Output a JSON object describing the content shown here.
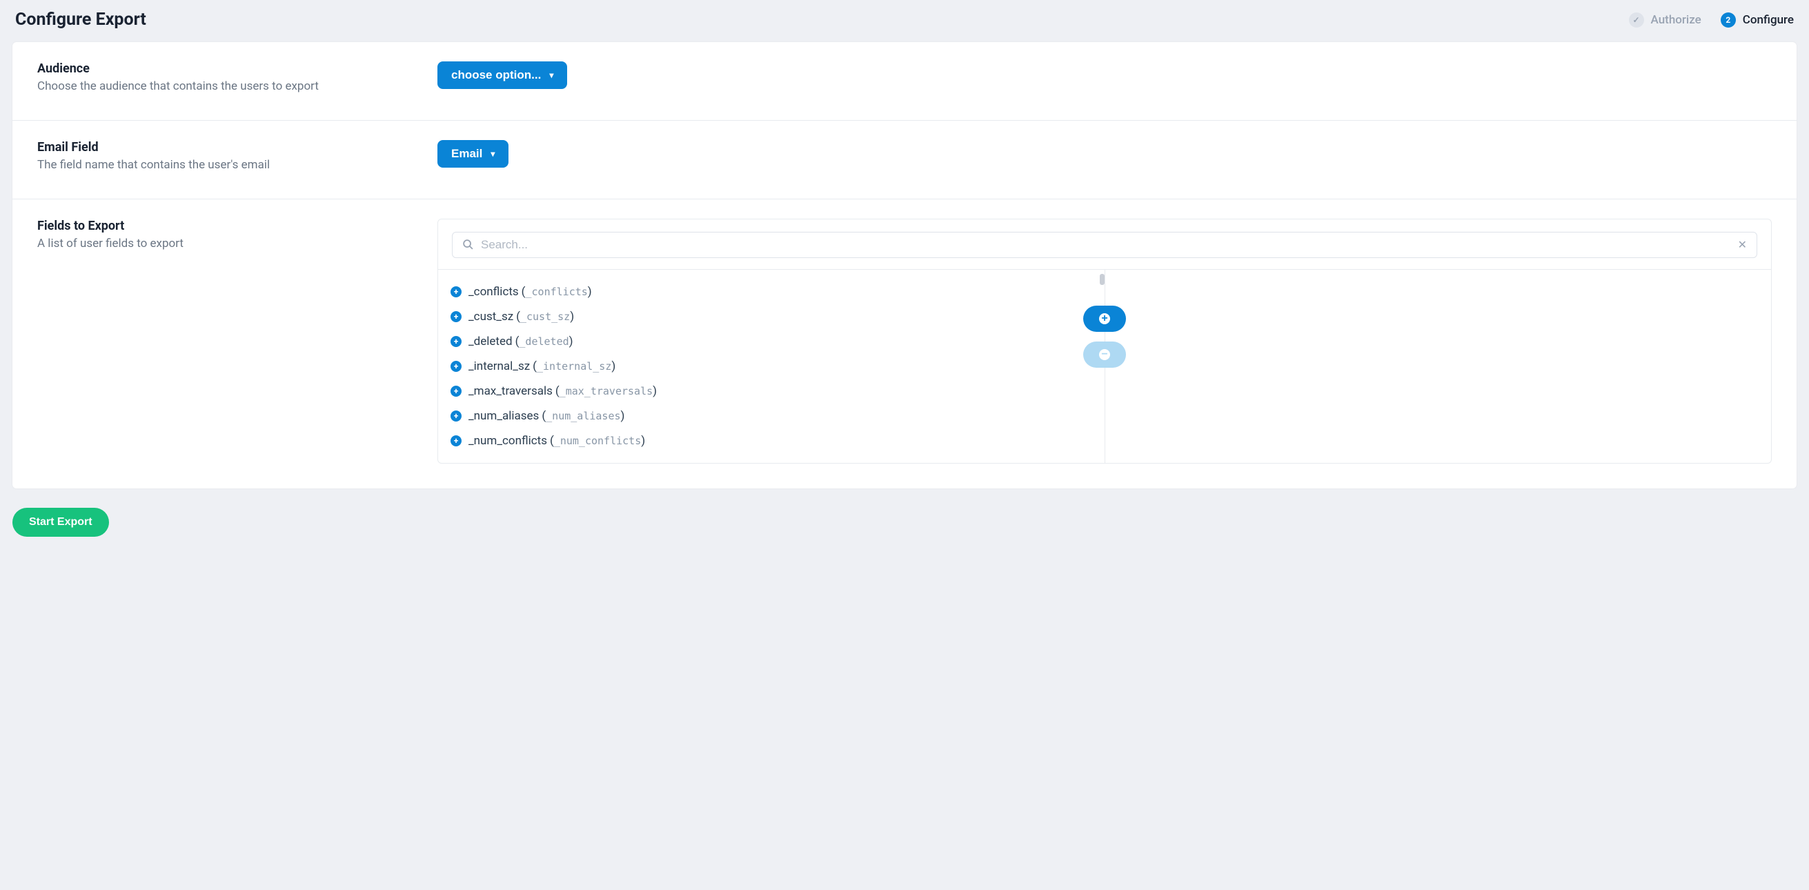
{
  "header": {
    "title": "Configure Export",
    "steps": [
      {
        "label": "Authorize",
        "state": "done",
        "bubble": "✓"
      },
      {
        "label": "Configure",
        "state": "active",
        "bubble": "2"
      }
    ]
  },
  "sections": {
    "audience": {
      "title": "Audience",
      "desc": "Choose the audience that contains the users to export",
      "dropdown_label": "choose option..."
    },
    "email_field": {
      "title": "Email Field",
      "desc": "The field name that contains the user's email",
      "dropdown_label": "Email"
    },
    "fields_to_export": {
      "title": "Fields to Export",
      "desc": "A list of user fields to export",
      "search_placeholder": "Search...",
      "available": [
        {
          "name": "_conflicts",
          "alias": "_conflicts"
        },
        {
          "name": "_cust_sz",
          "alias": "_cust_sz"
        },
        {
          "name": "_deleted",
          "alias": "_deleted"
        },
        {
          "name": "_internal_sz",
          "alias": "_internal_sz"
        },
        {
          "name": "_max_traversals",
          "alias": "_max_traversals"
        },
        {
          "name": "_num_aliases",
          "alias": "_num_aliases"
        },
        {
          "name": "_num_conflicts",
          "alias": "_num_conflicts"
        }
      ]
    }
  },
  "footer": {
    "start_label": "Start Export"
  }
}
